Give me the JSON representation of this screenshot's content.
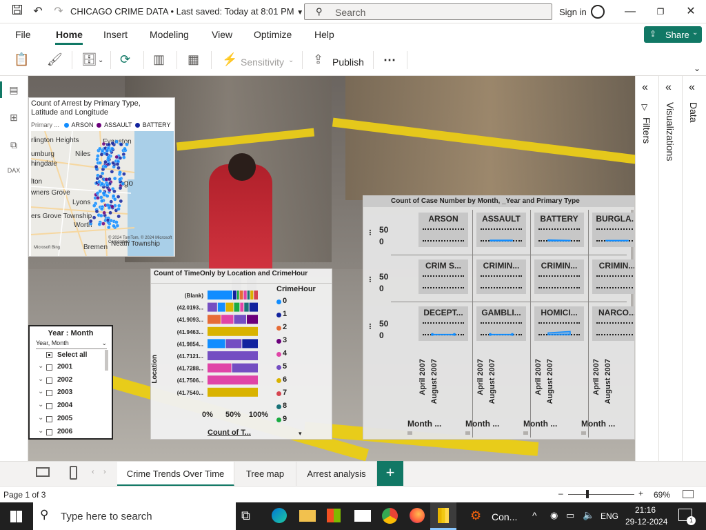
{
  "titlebar": {
    "title": "CHICAGO CRIME DATA",
    "saved": "• Last saved: Today at 8:01 PM",
    "search_placeholder": "Search",
    "signin": "Sign in"
  },
  "menu": {
    "items": [
      "File",
      "Home",
      "Insert",
      "Modeling",
      "View",
      "Optimize",
      "Help"
    ],
    "share": "Share"
  },
  "ribbon": {
    "sensitivity": "Sensitivity",
    "publish": "Publish",
    "more": "⋯"
  },
  "panes": {
    "filters": "Filters",
    "visualizations": "Visualizations",
    "data": "Data"
  },
  "map": {
    "title": "Count of Arrest by Primary Type, Latitude and Longitude",
    "legend_label": "Primary ...",
    "legend": [
      {
        "name": "ARSON",
        "color": "#118dff"
      },
      {
        "name": "ASSAULT",
        "color": "#6b007b"
      },
      {
        "name": "BATTERY",
        "color": "#12239e"
      }
    ],
    "places": [
      "rlington Heights",
      "Evanston",
      "umburg",
      "Niles",
      "hingdale",
      "ago",
      "lton",
      "wners Grove",
      "Lyons",
      "ers Grove Township",
      "Worth",
      "Bremen",
      "Neath Township"
    ],
    "attrib": "© 2024 TomTom, © 2024 Microsoft Corporation",
    "brand": "Microsoft Bing"
  },
  "slicer": {
    "title": "Year : Month",
    "dropdown": "Year, Month",
    "select_all": "Select all",
    "years": [
      "2001",
      "2002",
      "2003",
      "2004",
      "2005",
      "2006"
    ]
  },
  "barchart": {
    "title": "Count of TimeOnly by Location and CrimeHour",
    "ylabel": "Location",
    "xlabel": "Count of T...",
    "xticks": [
      "0%",
      "50%",
      "100%"
    ],
    "locations": [
      "(Blank)",
      "(42.0193...",
      "(41.9093...",
      "(41.9463...",
      "(41.9854...",
      "(41.7121...",
      "(41.7288...",
      "(41.7506...",
      "(41.7540..."
    ],
    "legend_title": "CrimeHour",
    "legend": [
      {
        "name": "0",
        "color": "#118dff"
      },
      {
        "name": "1",
        "color": "#12239e"
      },
      {
        "name": "2",
        "color": "#e66c37"
      },
      {
        "name": "3",
        "color": "#6b007b"
      },
      {
        "name": "4",
        "color": "#e044a7"
      },
      {
        "name": "5",
        "color": "#744ec2"
      },
      {
        "name": "6",
        "color": "#d9b300"
      },
      {
        "name": "7",
        "color": "#d64550"
      },
      {
        "name": "8",
        "color": "#197278"
      },
      {
        "name": "9",
        "color": "#1aab40"
      }
    ]
  },
  "smallmult": {
    "title": "Count of Case Number by Month, _Year and Primary Type",
    "y_ticks": [
      "50",
      "0"
    ],
    "cells": [
      "ARSON",
      "ASSAULT",
      "BATTERY",
      "BURGLA...",
      "CRIM S...",
      "CRIMIN...",
      "CRIMIN...",
      "CRIMIN...",
      "DECEPT...",
      "GAMBLI...",
      "HOMICI...",
      "NARCO..."
    ],
    "x_ticks": [
      "April 2007",
      "August 2007"
    ],
    "x_label": "Month ..."
  },
  "tabs": {
    "items": [
      "Crime Trends Over Time",
      "Tree map",
      "Arrest analysis"
    ],
    "add": "+"
  },
  "status": {
    "page": "Page 1 of 3",
    "zoom": "69%"
  },
  "taskbar": {
    "search": "Type here to search",
    "app_label": "Con...",
    "lang": "ENG",
    "time": "21:16",
    "date": "29-12-2024",
    "notif": "1"
  },
  "chart_data": [
    {
      "type": "bar",
      "title": "Count of TimeOnly by Location and CrimeHour",
      "xlabel": "Count of T...",
      "ylabel": "Location",
      "categories": [
        "(Blank)",
        "(42.0193...",
        "(41.9093...",
        "(41.9463...",
        "(41.9854...",
        "(41.7121...",
        "(41.7288...",
        "(41.7506...",
        "(41.7540..."
      ],
      "xlim": [
        0,
        100
      ],
      "stacked_percent": true,
      "rows": [
        [
          {
            "s": "0",
            "v": 50
          },
          {
            "s": "1",
            "v": 8
          },
          {
            "s": "9",
            "v": 5
          },
          {
            "s": "2",
            "v": 8
          },
          {
            "s": "4",
            "v": 7
          },
          {
            "s": "8",
            "v": 6
          },
          {
            "s": "6",
            "v": 7
          },
          {
            "s": "7",
            "v": 9
          }
        ],
        [
          {
            "s": "5",
            "v": 20
          },
          {
            "s": "0",
            "v": 16
          },
          {
            "s": "6",
            "v": 16
          },
          {
            "s": "9",
            "v": 12
          },
          {
            "s": "4",
            "v": 8
          },
          {
            "s": "8",
            "v": 10
          },
          {
            "s": "1",
            "v": 18
          }
        ],
        [
          {
            "s": "2",
            "v": 27
          },
          {
            "s": "4",
            "v": 25
          },
          {
            "s": "5",
            "v": 25
          },
          {
            "s": "3",
            "v": 23
          }
        ],
        [
          {
            "s": "6",
            "v": 100
          }
        ],
        [
          {
            "s": "0",
            "v": 36
          },
          {
            "s": "5",
            "v": 32
          },
          {
            "s": "1",
            "v": 32
          }
        ],
        [
          {
            "s": "5",
            "v": 100
          }
        ],
        [
          {
            "s": "4",
            "v": 48
          },
          {
            "s": "5",
            "v": 52
          }
        ],
        [
          {
            "s": "4",
            "v": 100
          }
        ],
        [
          {
            "s": "6",
            "v": 100
          }
        ]
      ]
    },
    {
      "type": "area",
      "title": "Count of Case Number by Month, _Year and Primary Type",
      "x": [
        "April 2007",
        "August 2007"
      ],
      "ylim": [
        0,
        50
      ],
      "series": [
        {
          "name": "ARSON",
          "values": [
            0,
            0
          ]
        },
        {
          "name": "ASSAULT",
          "values": [
            3,
            3
          ]
        },
        {
          "name": "BATTERY",
          "values": [
            4,
            2
          ]
        },
        {
          "name": "BURGLA...",
          "values": [
            2,
            2
          ]
        },
        {
          "name": "CRIM S...",
          "values": [
            0,
            0
          ]
        },
        {
          "name": "CRIMIN...",
          "values": [
            0,
            0
          ]
        },
        {
          "name": "CRIMIN...",
          "values": [
            0,
            0
          ]
        },
        {
          "name": "CRIMIN...",
          "values": [
            0,
            0
          ]
        },
        {
          "name": "DECEPT...",
          "values": [
            1,
            1
          ]
        },
        {
          "name": "GAMBLI...",
          "values": [
            1,
            1
          ]
        },
        {
          "name": "HOMICI...",
          "values": [
            8,
            14
          ]
        },
        {
          "name": "NARCO...",
          "values": [
            0,
            0
          ]
        }
      ]
    }
  ]
}
